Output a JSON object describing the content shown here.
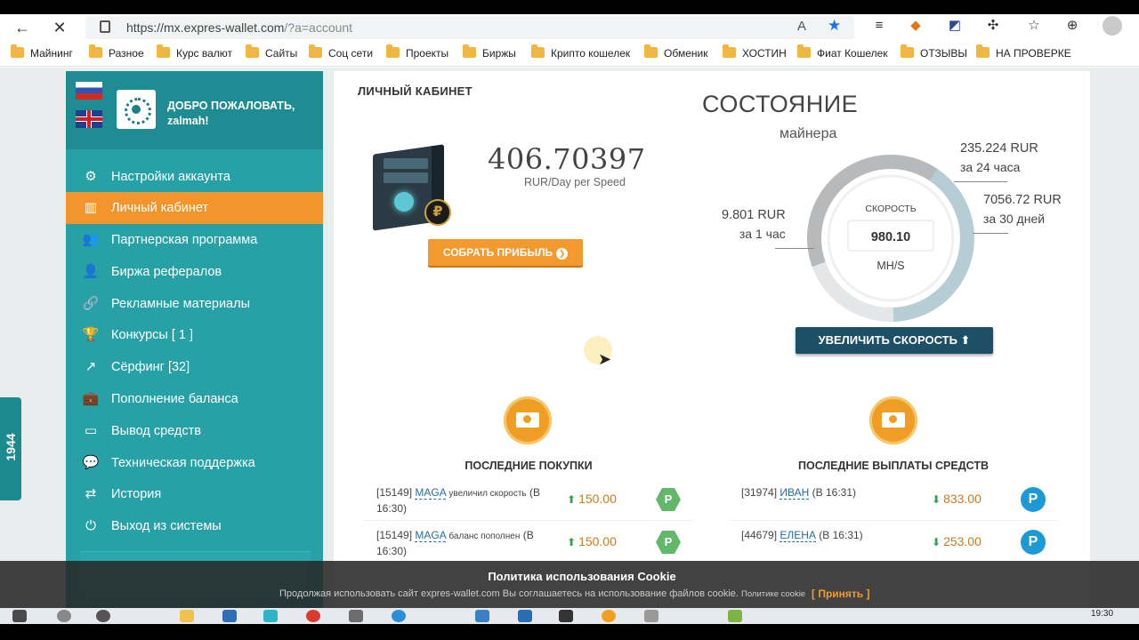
{
  "browser": {
    "url_host": "https://mx.expres-wallet.com",
    "url_path": "/?a=account",
    "bookmarks": [
      "Майнинг",
      "Разное",
      "Курс валют",
      "Сайты",
      "Соц сети",
      "Проекты",
      "Биржы",
      "Крипто кошелек",
      "Обменик",
      "ХОСТИН",
      "Фиат Кошелек",
      "ОТЗЫВЫ",
      "НА ПРОВЕРКЕ"
    ]
  },
  "sidebar": {
    "welcome_line1": "ДОБРО ПОЖАЛОВАТЬ,",
    "welcome_line2": "zalmah!",
    "items": [
      {
        "label": "Настройки аккаунта",
        "icon": "gears-icon"
      },
      {
        "label": "Личный кабинет",
        "icon": "bar-chart-icon"
      },
      {
        "label": "Партнерская программа",
        "icon": "users-icon"
      },
      {
        "label": "Биржа рефералов",
        "icon": "user-plus-icon"
      },
      {
        "label": "Рекламные материалы",
        "icon": "link-icon"
      },
      {
        "label": "Конкурсы [ 1 ]",
        "icon": "trophy-icon"
      },
      {
        "label": "Сёрфинг [32]",
        "icon": "external-link-icon"
      },
      {
        "label": "Пополнение баланса",
        "icon": "briefcase-icon"
      },
      {
        "label": "Вывод средств",
        "icon": "credit-card-icon"
      },
      {
        "label": "Техническая поддержка",
        "icon": "chat-icon"
      },
      {
        "label": "История",
        "icon": "exchange-icon"
      },
      {
        "label": "Выход из системы",
        "icon": "power-icon"
      }
    ],
    "active_index": 1
  },
  "side_tab": {
    "count": "1944"
  },
  "cabinet": {
    "title": "ЛИЧНЫЙ КАБИНЕТ",
    "balance": "406.70397",
    "unit": "RUR/Day per Speed",
    "collect_label": "СОБРАТЬ ПРИБЫЛЬ"
  },
  "state": {
    "title": "СОСТОЯНИЕ",
    "subtitle": "майнера",
    "speed_label": "СКОРОСТЬ",
    "speed_value": "980.10",
    "speed_unit": "MH/S",
    "per_hour_value": "9.801 RUR",
    "per_hour_label": "за 1 час",
    "per_day_value": "235.224 RUR",
    "per_day_label": "за 24 часа",
    "per_month_value": "7056.72 RUR",
    "per_month_label": "за 30 дней",
    "increase_label": "УВЕЛИЧИТЬ СКОРОСТЬ",
    "gauge_fill": 0.8,
    "colors": {
      "gauge_outer": "#b7b9ba",
      "gauge_inner": "#b7cdd6",
      "accent": "#f2962b",
      "sidebar": "#27a0a6"
    }
  },
  "purchases": {
    "title": "ПОСЛЕДНИЕ ПОКУПКИ",
    "rows": [
      {
        "id": "[15149]",
        "user": "MAGA",
        "action": "увеличил скорость",
        "time": "(В 16:30)",
        "amount": "150.00"
      },
      {
        "id": "[15149]",
        "user": "MAGA",
        "action": "баланс пополнен",
        "time": "(В 16:30)",
        "amount": "150.00"
      }
    ]
  },
  "payouts": {
    "title": "ПОСЛЕДНИЕ ВЫПЛАТЫ СРЕДСТВ",
    "rows": [
      {
        "id": "[31974]",
        "user": "ИВАН",
        "time": "(В 16:31)",
        "amount": "833.00"
      },
      {
        "id": "[44679]",
        "user": "ЕЛЕНА",
        "time": "(В 16:31)",
        "amount": "253.00"
      }
    ]
  },
  "cookie": {
    "title": "Политика использования Cookie",
    "text": "Продолжая использовать сайт expres-wallet.com Вы соглашаетесь на использование файлов cookie.",
    "policy_link": "Политике cookie",
    "accept": "[ Принять ]"
  },
  "taskbar": {
    "time": "19:30"
  }
}
